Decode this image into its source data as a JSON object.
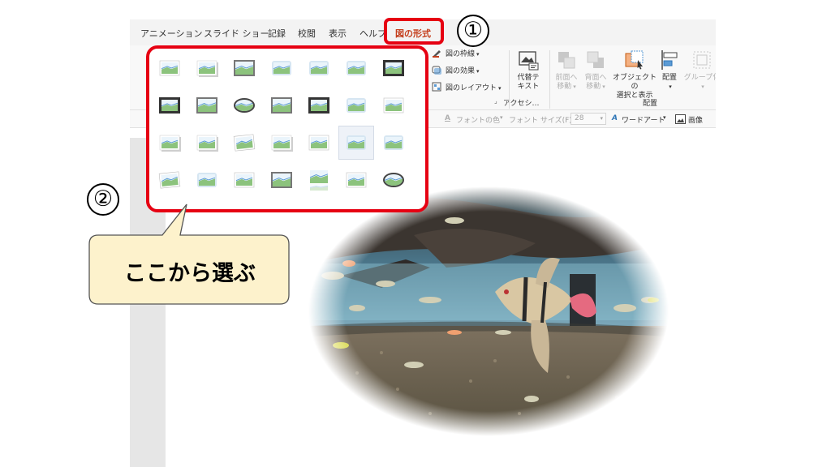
{
  "tabs": [
    "アニメーション",
    "スライド ショー",
    "記録",
    "校閲",
    "表示",
    "ヘルプ",
    "図の形式"
  ],
  "ribbon": {
    "border_label": "図の枠線",
    "effects_label": "図の効果",
    "layout_label": "図のレイアウト",
    "accessibility_label": "アクセシ…",
    "alt_text_line1": "代替テ",
    "alt_text_line2": "キスト",
    "bring_forward_line1": "前面へ",
    "bring_forward_line2": "移動",
    "send_backward_line1": "背面へ",
    "send_backward_line2": "移動",
    "selection_pane_line1": "オブジェクトの",
    "selection_pane_line2": "選択と表示",
    "align_label": "配置",
    "group_label": "グループ化",
    "arrange_group": "配置"
  },
  "format_bar": {
    "font_color": "フォントの色",
    "font_size_label": "フォント サイズ(F):",
    "font_size_value": "28",
    "wordart": "ワードアート",
    "picture": "画像"
  },
  "annotations": {
    "step1": "①",
    "step2": "②",
    "callout": "ここから選ぶ"
  },
  "colors": {
    "accent_red": "#e60012",
    "tab_active": "#c43e1c",
    "callout_fill": "#fdf2cc"
  },
  "gallery": {
    "rows": 4,
    "columns": 7,
    "selected_index": 19
  }
}
